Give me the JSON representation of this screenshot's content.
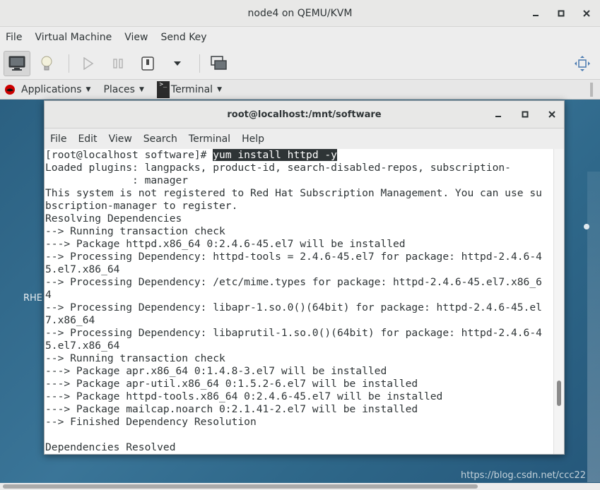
{
  "window": {
    "title": "node4 on QEMU/KVM",
    "controls": {
      "minimize": "_",
      "maximize": "□",
      "close": "✕"
    }
  },
  "menubar": [
    "File",
    "Virtual Machine",
    "View",
    "Send Key"
  ],
  "toolbar": {
    "icons": [
      "monitor-icon",
      "lightbulb-icon",
      "play-icon",
      "pause-icon",
      "power-icon",
      "dropdown-icon",
      "screenshot-icon",
      "fullscreen-icon"
    ]
  },
  "guest": {
    "top_bar": {
      "applications": "Applications",
      "places": "Places",
      "terminal": "Terminal"
    },
    "desktop_label": "RHE",
    "watermark": "https://blog.csdn.net/ccc22"
  },
  "terminal": {
    "title": "root@localhost:/mnt/software",
    "controls": {
      "minimize": "_",
      "maximize": "□",
      "close": "✕"
    },
    "menu": [
      "File",
      "Edit",
      "View",
      "Search",
      "Terminal",
      "Help"
    ],
    "prompt": "[root@localhost software]# ",
    "command": "yum install httpd -y",
    "output": [
      "Loaded plugins: langpacks, product-id, search-disabled-repos, subscription-",
      "              : manager",
      "This system is not registered to Red Hat Subscription Management. You can use su",
      "bscription-manager to register.",
      "Resolving Dependencies",
      "--> Running transaction check",
      "---> Package httpd.x86_64 0:2.4.6-45.el7 will be installed",
      "--> Processing Dependency: httpd-tools = 2.4.6-45.el7 for package: httpd-2.4.6-4",
      "5.el7.x86_64",
      "--> Processing Dependency: /etc/mime.types for package: httpd-2.4.6-45.el7.x86_6",
      "4",
      "--> Processing Dependency: libapr-1.so.0()(64bit) for package: httpd-2.4.6-45.el",
      "7.x86_64",
      "--> Processing Dependency: libaprutil-1.so.0()(64bit) for package: httpd-2.4.6-4",
      "5.el7.x86_64",
      "--> Running transaction check",
      "---> Package apr.x86_64 0:1.4.8-3.el7 will be installed",
      "---> Package apr-util.x86_64 0:1.5.2-6.el7 will be installed",
      "---> Package httpd-tools.x86_64 0:2.4.6-45.el7 will be installed",
      "---> Package mailcap.noarch 0:2.1.41-2.el7 will be installed",
      "--> Finished Dependency Resolution",
      "",
      "Dependencies Resolved"
    ]
  }
}
